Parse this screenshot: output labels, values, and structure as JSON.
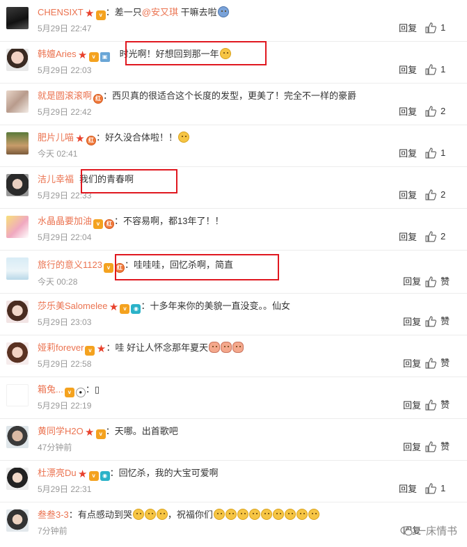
{
  "ui": {
    "reply_label": "回复",
    "like_zero_label": "赞"
  },
  "watermark": "一床情书",
  "comments": [
    {
      "user": "CHENSIXT",
      "colon": "：",
      "text_before": "差一只",
      "mention": "@安又琪",
      "text": " 干嘛去啦",
      "time": "5月29日 22:47",
      "likes": "1"
    },
    {
      "user": "韩嬗Aries",
      "colon": "",
      "text": "时光啊！好想回到那一年",
      "time": "5月29日 22:03",
      "likes": "1"
    },
    {
      "user": "就是圆滚滚啊",
      "colon": "：",
      "text": "西贝真的很适合这个长度的发型，更美了！完全不一样的豪爵",
      "time": "5月29日 22:42",
      "likes": "2"
    },
    {
      "user": "肥片儿喵",
      "colon": "：",
      "text": "好久没合体啦！！",
      "time": "今天 02:41",
      "likes": "1"
    },
    {
      "user": "洁儿幸福",
      "colon": "",
      "text": "我们的青春啊",
      "time": "5月29日 22:33",
      "likes": "2"
    },
    {
      "user": "水晶晶要加油",
      "colon": "：",
      "text": "不容易啊，都13年了！！",
      "time": "5月29日 22:04",
      "likes": "2"
    },
    {
      "user": "旅行的意义1123",
      "colon": "：",
      "text": "哇哇哇，回忆杀啊，简直",
      "time": "今天 00:28",
      "likes": ""
    },
    {
      "user": "莎乐美Salomelee",
      "colon": "：",
      "text": "十多年来你的美貌一直没变。。仙女",
      "time": "5月29日 23:03",
      "likes": ""
    },
    {
      "user": "娅莉forever",
      "colon": "：",
      "text": "哇 好让人怀念那年夏天",
      "time": "5月29日 22:58",
      "likes": ""
    },
    {
      "user": "箱兔...",
      "colon": "：",
      "text": "▯",
      "time": "5月29日 22:19",
      "likes": ""
    },
    {
      "user": "黄同学H2O",
      "colon": "：",
      "text": "天哪。出首歌吧",
      "time": "47分钟前",
      "likes": ""
    },
    {
      "user": "杜漂亮Du",
      "colon": "：",
      "text": "回忆杀，我的大宝可爱啊",
      "time": "5月29日 22:31",
      "likes": "1"
    },
    {
      "user": "叁叁3-3",
      "colon": "：",
      "text": "有点感动到哭",
      "text_after": "，祝福你们",
      "time": "7分钟前",
      "likes": ""
    }
  ],
  "colors": {
    "username": "#eb7350",
    "highlight_box": "#e0171f",
    "meta_gray": "#999999"
  }
}
